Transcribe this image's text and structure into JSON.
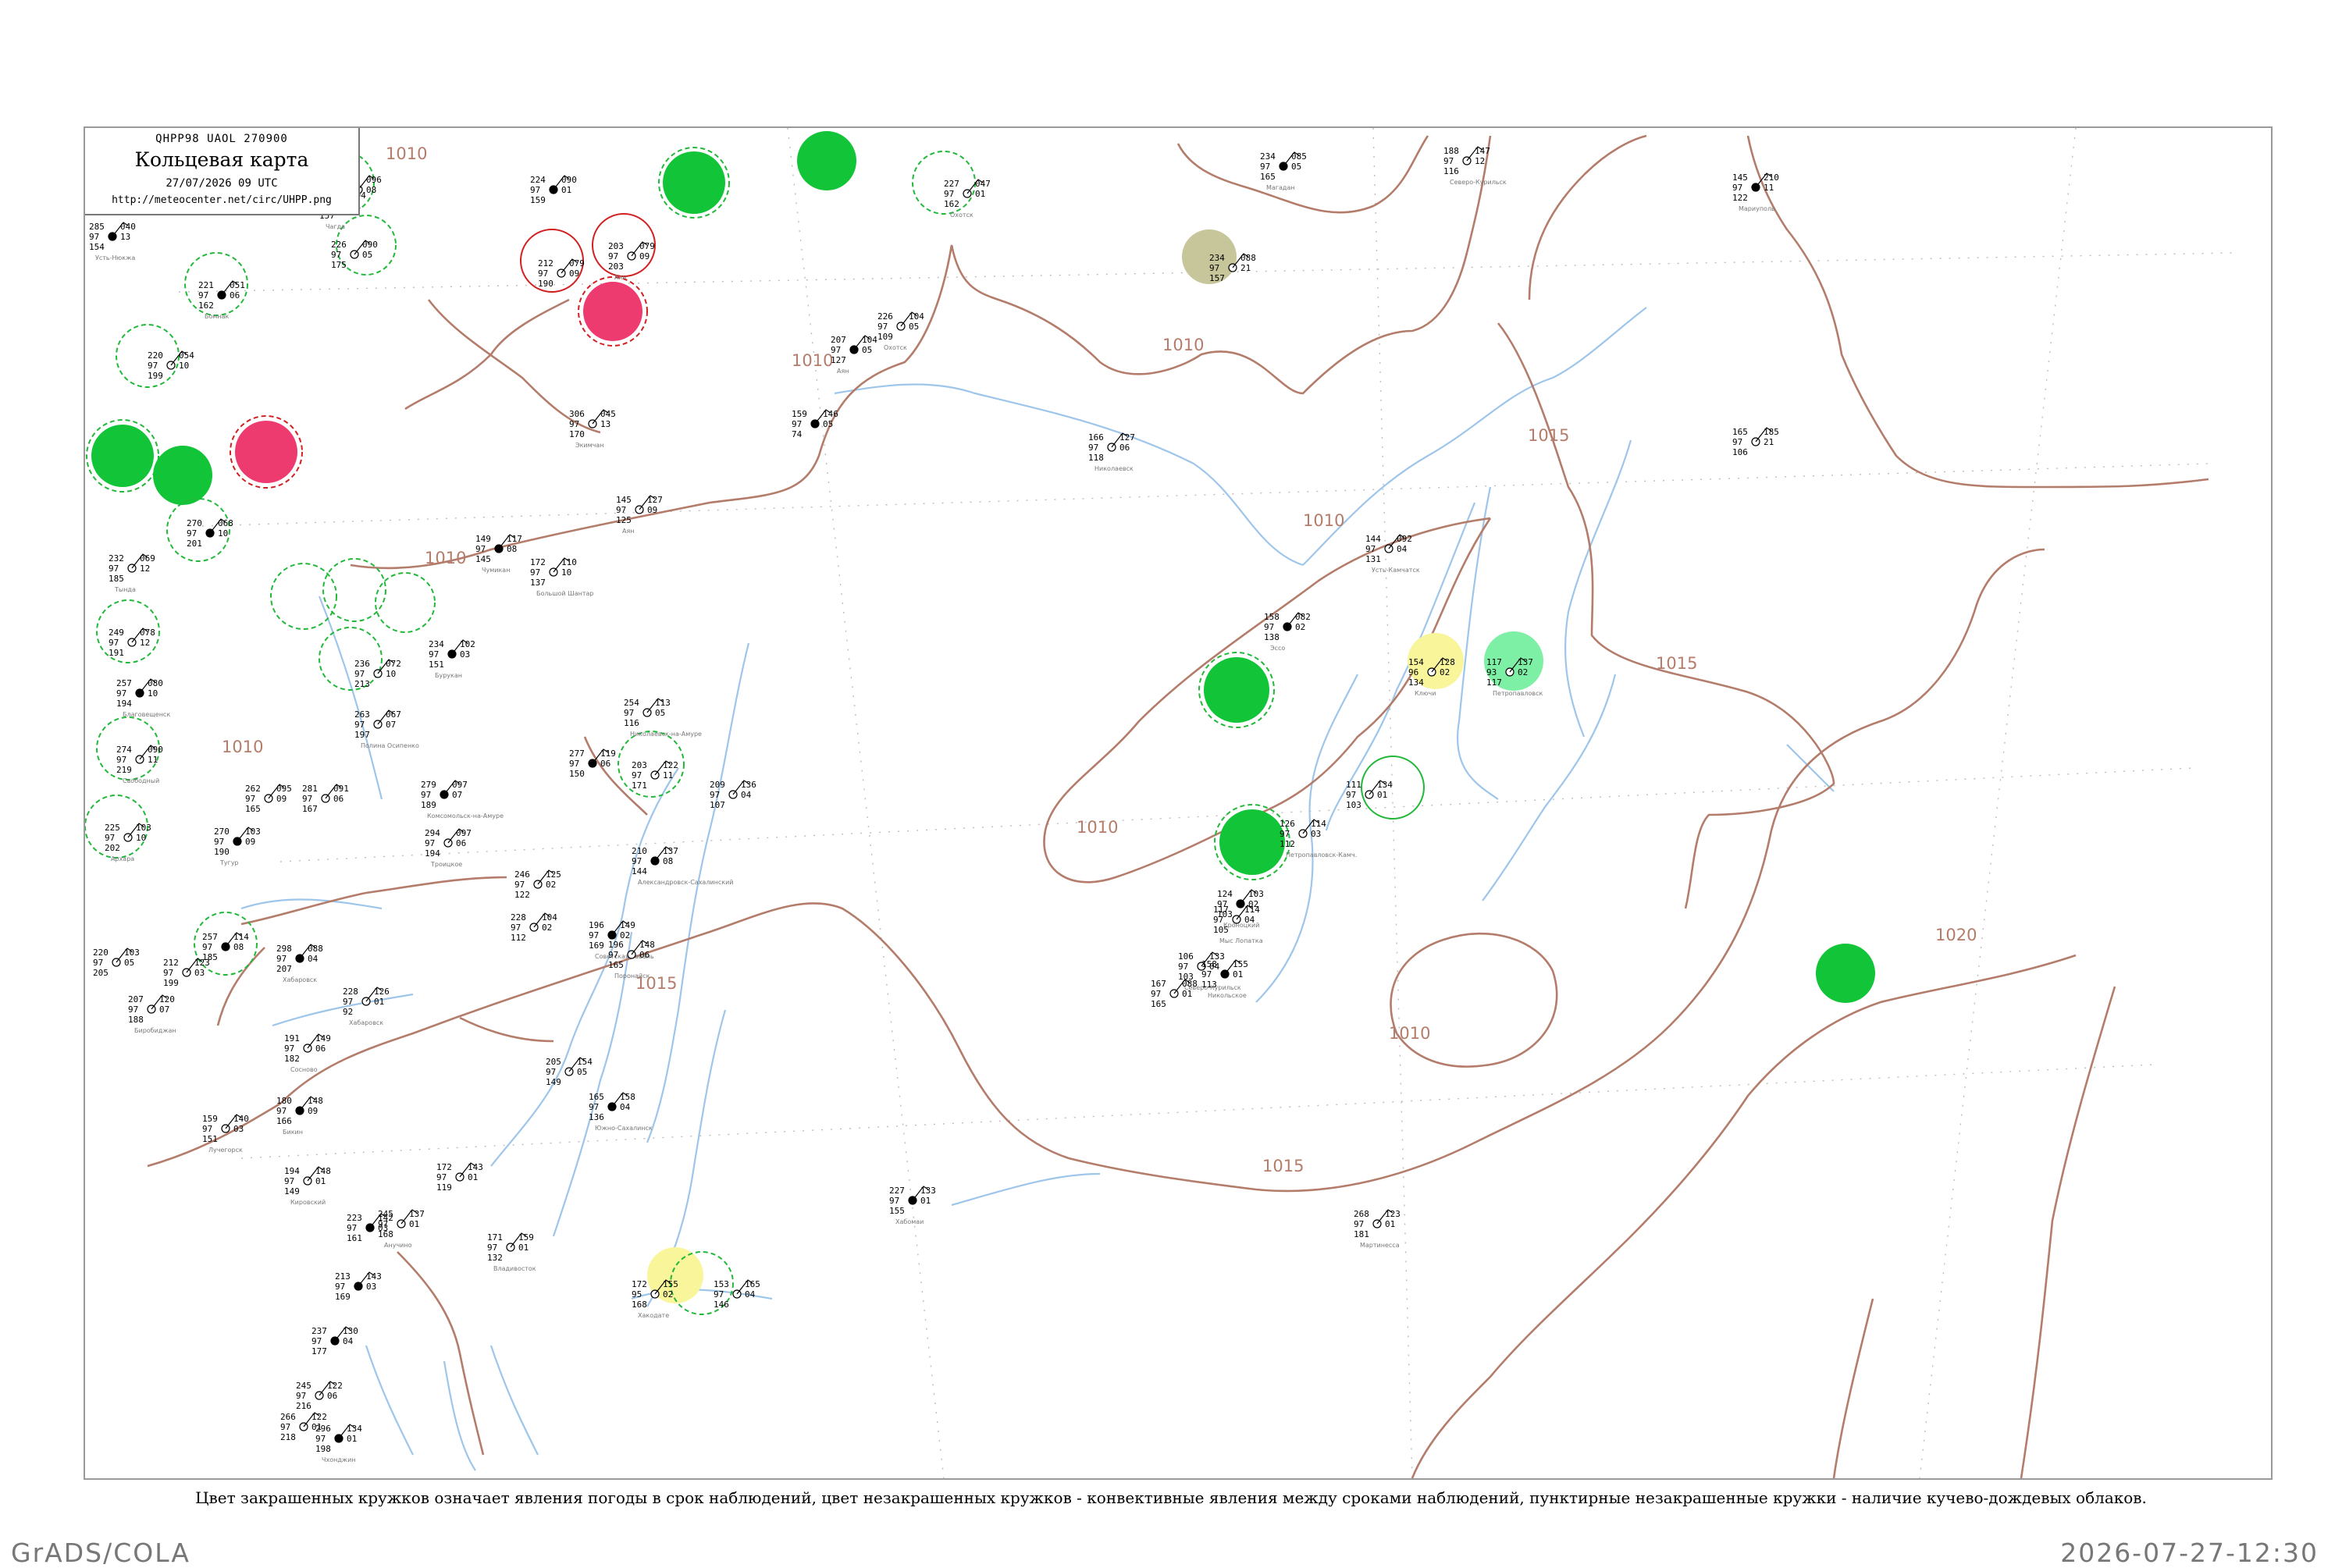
{
  "legend": {
    "code": "QHPP98  UAOL  270900",
    "title": "Кольцевая карта",
    "date": "27/07/2026 09 UTC",
    "url": "http://meteocenter.net/circ/UHPP.png"
  },
  "caption": "Цвет закрашенных кружков означает явления погоды в срок наблюдений, цвет незакрашенных кружков - конвективные явления между сроками наблюдений, пунктирные незакрашенные кружки - наличие кучево-дождевых облаков.",
  "footer": {
    "left": "GrADS/COLA",
    "right": "2026-07-27-12:30"
  },
  "colors": {
    "isobar": "#b47c6a",
    "coast": "#9ec5ea",
    "green": "#12c437",
    "pink": "#ee3b6f",
    "yellow": "#f8f59a",
    "olive": "#c6c69a",
    "mint": "#7ef0a5",
    "red_ring": "#d22020",
    "green_ring": "#22b83a"
  },
  "isobar_labels": [
    {
      "id": "iso-1010-a",
      "text": "1010"
    },
    {
      "id": "iso-1010-b",
      "text": "1010"
    },
    {
      "id": "iso-1010-c",
      "text": "1010"
    },
    {
      "id": "iso-1010-d",
      "text": "1010"
    },
    {
      "id": "iso-1010-e",
      "text": "1010"
    },
    {
      "id": "iso-1010-f",
      "text": "1010"
    },
    {
      "id": "iso-1010-g",
      "text": "1010"
    },
    {
      "id": "iso-1010-h",
      "text": "1010"
    },
    {
      "id": "iso-1015-a",
      "text": "1015"
    },
    {
      "id": "iso-1015-b",
      "text": "1015"
    },
    {
      "id": "iso-1015-c",
      "text": "1015"
    },
    {
      "id": "iso-1015-d",
      "text": "1015"
    },
    {
      "id": "iso-1020-a",
      "text": "1020"
    }
  ],
  "stations": [
    {
      "temp": "285",
      "pres": "040",
      "vis": "97",
      "td": "154",
      "tend": "13",
      "name": "Усть-Нюкжа"
    },
    {
      "temp": "229",
      "pres": "096",
      "vis": "97",
      "td": "187",
      "tend": "08",
      "name": ""
    },
    {
      "temp": "226",
      "pres": "090",
      "vis": "97",
      "td": "175",
      "tend": "05",
      "name": ""
    },
    {
      "temp": "221",
      "pres": "051",
      "vis": "97",
      "td": "162",
      "tend": "06",
      "name": "Бомнак"
    },
    {
      "temp": "220",
      "pres": "054",
      "vis": "97",
      "td": "199",
      "tend": "10",
      "name": ""
    },
    {
      "temp": "203",
      "pres": "094",
      "vis": "92",
      "td": "157",
      "tend": "01",
      "name": "Чагда"
    },
    {
      "temp": "224",
      "pres": "090",
      "vis": "97",
      "td": "159",
      "tend": "01",
      "name": ""
    },
    {
      "temp": "212",
      "pres": "079",
      "vis": "97",
      "td": "190",
      "tend": "09",
      "name": ""
    },
    {
      "temp": "203",
      "pres": "079",
      "vis": "97",
      "td": "203",
      "tend": "09",
      "name": "Аян"
    },
    {
      "temp": "207",
      "pres": "104",
      "vis": "97",
      "td": "127",
      "tend": "05",
      "name": "Аян"
    },
    {
      "temp": "226",
      "pres": "104",
      "vis": "97",
      "td": "109",
      "tend": "05",
      "name": "Охотск"
    },
    {
      "temp": "227",
      "pres": "047",
      "vis": "97",
      "td": "162",
      "tend": "01",
      "name": "Охотск"
    },
    {
      "temp": "234",
      "pres": "085",
      "vis": "97",
      "td": "165",
      "tend": "05",
      "name": "Магадан"
    },
    {
      "temp": "234",
      "pres": "088",
      "vis": "97",
      "td": "157",
      "tend": "21",
      "name": ""
    },
    {
      "temp": "188",
      "pres": "147",
      "vis": "97",
      "td": "116",
      "tend": "12",
      "name": "Северо-Курильск"
    },
    {
      "temp": "145",
      "pres": "210",
      "vis": "97",
      "td": "122",
      "tend": "11",
      "name": "Мариуполь"
    },
    {
      "temp": "165",
      "pres": "185",
      "vis": "97",
      "td": "106",
      "tend": "21",
      "name": ""
    },
    {
      "temp": "306",
      "pres": "045",
      "vis": "97",
      "td": "170",
      "tend": "13",
      "name": "Экимчан"
    },
    {
      "temp": "159",
      "pres": "146",
      "vis": "97",
      "td": "74",
      "tend": "05",
      "name": ""
    },
    {
      "temp": "166",
      "pres": "127",
      "vis": "97",
      "td": "118",
      "tend": "06",
      "name": "Николаевск"
    },
    {
      "temp": "145",
      "pres": "127",
      "vis": "97",
      "td": "125",
      "tend": "09",
      "name": "Аян"
    },
    {
      "temp": "149",
      "pres": "117",
      "vis": "97",
      "td": "145",
      "tend": "08",
      "name": "Чумикан"
    },
    {
      "temp": "172",
      "pres": "110",
      "vis": "97",
      "td": "137",
      "tend": "10",
      "name": "Большой Шантар"
    },
    {
      "temp": "144",
      "pres": "092",
      "vis": "97",
      "td": "131",
      "tend": "04",
      "name": "Усть-Камчатск"
    },
    {
      "temp": "158",
      "pres": "082",
      "vis": "97",
      "td": "138",
      "tend": "02",
      "name": "Эссо"
    },
    {
      "temp": "154",
      "pres": "128",
      "vis": "96",
      "td": "134",
      "tend": "02",
      "name": "Ключи"
    },
    {
      "temp": "117",
      "pres": "137",
      "vis": "93",
      "td": "117",
      "tend": "02",
      "name": "Петропавловск"
    },
    {
      "temp": "270",
      "pres": "068",
      "vis": "97",
      "td": "201",
      "tend": "10",
      "name": ""
    },
    {
      "temp": "232",
      "pres": "069",
      "vis": "97",
      "td": "185",
      "tend": "12",
      "name": "Тында"
    },
    {
      "temp": "249",
      "pres": "078",
      "vis": "97",
      "td": "191",
      "tend": "12",
      "name": ""
    },
    {
      "temp": "257",
      "pres": "080",
      "vis": "97",
      "td": "194",
      "tend": "10",
      "name": "Благовещенск"
    },
    {
      "temp": "274",
      "pres": "090",
      "vis": "97",
      "td": "219",
      "tend": "11",
      "name": "Свободный"
    },
    {
      "temp": "236",
      "pres": "072",
      "vis": "97",
      "td": "213",
      "tend": "10",
      "name": ""
    },
    {
      "temp": "234",
      "pres": "102",
      "vis": "97",
      "td": "151",
      "tend": "03",
      "name": "Бурукан"
    },
    {
      "temp": "263",
      "pres": "067",
      "vis": "97",
      "td": "197",
      "tend": "07",
      "name": "Полина Осипенко"
    },
    {
      "temp": "254",
      "pres": "113",
      "vis": "97",
      "td": "116",
      "tend": "05",
      "name": "Николаевск-на-Амуре"
    },
    {
      "temp": "277",
      "pres": "119",
      "vis": "97",
      "td": "150",
      "tend": "06",
      "name": ""
    },
    {
      "temp": "203",
      "pres": "122",
      "vis": "97",
      "td": "171",
      "tend": "11",
      "name": ""
    },
    {
      "temp": "209",
      "pres": "136",
      "vis": "97",
      "td": "107",
      "tend": "04",
      "name": ""
    },
    {
      "temp": "279",
      "pres": "097",
      "vis": "97",
      "td": "189",
      "tend": "07",
      "name": "Комсомольск-на-Амуре"
    },
    {
      "temp": "262",
      "pres": "095",
      "vis": "97",
      "td": "165",
      "tend": "09",
      "name": ""
    },
    {
      "temp": "281",
      "pres": "091",
      "vis": "97",
      "td": "167",
      "tend": "06",
      "name": ""
    },
    {
      "temp": "270",
      "pres": "103",
      "vis": "97",
      "td": "190",
      "tend": "09",
      "name": "Тугур"
    },
    {
      "temp": "225",
      "pres": "103",
      "vis": "97",
      "td": "202",
      "tend": "10",
      "name": "Архара"
    },
    {
      "temp": "294",
      "pres": "097",
      "vis": "97",
      "td": "194",
      "tend": "06",
      "name": "Троицкое"
    },
    {
      "temp": "210",
      "pres": "137",
      "vis": "97",
      "td": "144",
      "tend": "08",
      "name": "Александровск-Сахалинский"
    },
    {
      "temp": "246",
      "pres": "125",
      "vis": "97",
      "td": "122",
      "tend": "02",
      "name": ""
    },
    {
      "temp": "228",
      "pres": "104",
      "vis": "97",
      "td": "112",
      "tend": "02",
      "name": ""
    },
    {
      "temp": "196",
      "pres": "149",
      "vis": "97",
      "td": "169",
      "tend": "02",
      "name": "Советская Гавань"
    },
    {
      "temp": "196",
      "pres": "148",
      "vis": "97",
      "td": "165",
      "tend": "06",
      "name": "Поронайск"
    },
    {
      "temp": "220",
      "pres": "103",
      "vis": "97",
      "td": "205",
      "tend": "05",
      "name": ""
    },
    {
      "temp": "257",
      "pres": "114",
      "vis": "97",
      "td": "185",
      "tend": "08",
      "name": ""
    },
    {
      "temp": "212",
      "pres": "123",
      "vis": "97",
      "td": "199",
      "tend": "03",
      "name": ""
    },
    {
      "temp": "207",
      "pres": "120",
      "vis": "97",
      "td": "188",
      "tend": "07",
      "name": "Биробиджан"
    },
    {
      "temp": "298",
      "pres": "088",
      "vis": "97",
      "td": "207",
      "tend": "04",
      "name": "Хабаровск"
    },
    {
      "temp": "228",
      "pres": "126",
      "vis": "97",
      "td": "92",
      "tend": "01",
      "name": "Хабаровск"
    },
    {
      "temp": "191",
      "pres": "149",
      "vis": "97",
      "td": "182",
      "tend": "06",
      "name": "Сосново"
    },
    {
      "temp": "180",
      "pres": "148",
      "vis": "97",
      "td": "166",
      "tend": "09",
      "name": "Бикин"
    },
    {
      "temp": "159",
      "pres": "140",
      "vis": "97",
      "td": "151",
      "tend": "03",
      "name": "Лучегорск"
    },
    {
      "temp": "205",
      "pres": "154",
      "vis": "97",
      "td": "149",
      "tend": "05",
      "name": ""
    },
    {
      "temp": "165",
      "pres": "158",
      "vis": "97",
      "td": "136",
      "tend": "04",
      "name": "Южно-Сахалинск"
    },
    {
      "temp": "172",
      "pres": "143",
      "vis": "97",
      "td": "119",
      "tend": "01",
      "name": ""
    },
    {
      "temp": "194",
      "pres": "148",
      "vis": "97",
      "td": "149",
      "tend": "01",
      "name": "Кировский"
    },
    {
      "temp": "223",
      "pres": "142",
      "vis": "97",
      "td": "161",
      "tend": "03",
      "name": ""
    },
    {
      "temp": "245",
      "pres": "137",
      "vis": "97",
      "td": "168",
      "tend": "01",
      "name": "Анучино"
    },
    {
      "temp": "171",
      "pres": "159",
      "vis": "97",
      "td": "132",
      "tend": "01",
      "name": "Владивосток"
    },
    {
      "temp": "213",
      "pres": "143",
      "vis": "97",
      "td": "169",
      "tend": "03",
      "name": ""
    },
    {
      "temp": "172",
      "pres": "155",
      "vis": "95",
      "td": "168",
      "tend": "02",
      "name": "Хакодате"
    },
    {
      "temp": "153",
      "pres": "165",
      "vis": "97",
      "td": "146",
      "tend": "04",
      "name": ""
    },
    {
      "temp": "227",
      "pres": "133",
      "vis": "97",
      "td": "155",
      "tend": "01",
      "name": "Хабомаи"
    },
    {
      "temp": "126",
      "pres": "114",
      "vis": "97",
      "td": "112",
      "tend": "03",
      "name": "Петропавловск-Камч."
    },
    {
      "temp": "111",
      "pres": "134",
      "vis": "97",
      "td": "103",
      "tend": "01",
      "name": ""
    },
    {
      "temp": "124",
      "pres": "103",
      "vis": "97",
      "td": "103",
      "tend": "02",
      "name": "Кроноцкий"
    },
    {
      "temp": "117",
      "pres": "114",
      "vis": "97",
      "td": "105",
      "tend": "04",
      "name": "Мыс Лопатка"
    },
    {
      "temp": "106",
      "pres": "133",
      "vis": "97",
      "td": "103",
      "tend": "04",
      "name": "Северо-Курильск"
    },
    {
      "temp": "158",
      "pres": "155",
      "vis": "97",
      "td": "113",
      "tend": "01",
      "name": "Никольское"
    },
    {
      "temp": "167",
      "pres": "088",
      "vis": "97",
      "td": "165",
      "tend": "01",
      "name": ""
    },
    {
      "temp": "268",
      "pres": "123",
      "vis": "97",
      "td": "181",
      "tend": "01",
      "name": "Мартинесса"
    },
    {
      "temp": "237",
      "pres": "130",
      "vis": "97",
      "td": "177",
      "tend": "04",
      "name": ""
    },
    {
      "temp": "245",
      "pres": "122",
      "vis": "97",
      "td": "216",
      "tend": "06",
      "name": ""
    },
    {
      "temp": "266",
      "pres": "122",
      "vis": "97",
      "td": "218",
      "tend": "01",
      "name": ""
    },
    {
      "temp": "296",
      "pres": "134",
      "vis": "97",
      "td": "198",
      "tend": "01",
      "name": "Чхонджин"
    }
  ]
}
